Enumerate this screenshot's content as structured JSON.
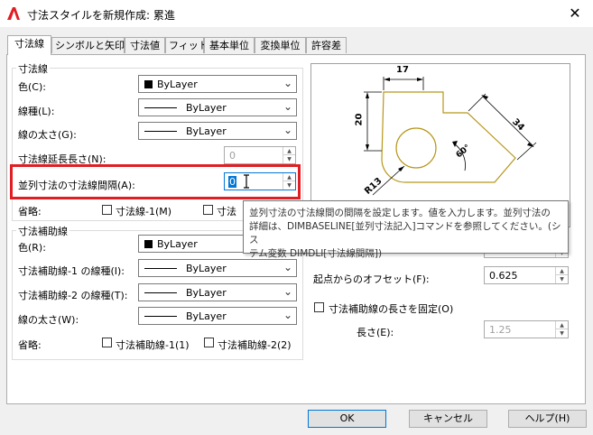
{
  "window": {
    "title": "寸法スタイルを新規作成: 累進",
    "close_glyph": "✕"
  },
  "tabs": [
    {
      "label": "寸法線"
    },
    {
      "label": "シンボルと矢印"
    },
    {
      "label": "寸法値"
    },
    {
      "label": "フィット"
    },
    {
      "label": "基本単位"
    },
    {
      "label": "変換単位"
    },
    {
      "label": "許容差"
    }
  ],
  "dim_lines": {
    "group_title": "寸法線",
    "color_label": "色(C):",
    "color_value": "ByLayer",
    "linetype_label": "線種(L):",
    "linetype_value": "ByLayer",
    "lineweight_label": "線の太さ(G):",
    "lineweight_value": "ByLayer",
    "extend_label": "寸法線延長長さ(N):",
    "extend_value": "0",
    "baseline_label": "並列寸法の寸法線間隔(A):",
    "baseline_value": "0",
    "suppress_label": "省略:",
    "suppress1_label": "寸法線-1(M)",
    "suppress2_label": "寸法"
  },
  "ext_lines": {
    "group_title": "寸法補助線",
    "color_label": "色(R):",
    "color_value": "ByLayer",
    "linetype1_label": "寸法補助線-1 の線種(I):",
    "linetype1_value": "ByLayer",
    "linetype2_label": "寸法補助線-2 の線種(T):",
    "linetype2_value": "ByLayer",
    "lineweight_label": "線の太さ(W):",
    "lineweight_value": "ByLayer",
    "suppress_label": "省略:",
    "suppress1_label": "寸法補助線-1(1)",
    "suppress2_label": "寸法補助線-2(2)",
    "offset_label": "起点からのオフセット(F):",
    "offset_value": "0.625",
    "fixed_label": "寸法補助線の長さを固定(O)",
    "length_label": "長さ(E):",
    "length_value": "1.25"
  },
  "tooltip": {
    "line1": "並列寸法の寸法線間の間隔を設定します。値を入力します。並列寸法の",
    "line2": "詳細は、DIMBASELINE[並列寸法記入]コマンドを参照してください。(シス",
    "line3": "テム変数 DIMDLI[寸法線間隔])"
  },
  "preview": {
    "dim_17": "17",
    "dim_20": "20",
    "dim_34": "34",
    "dim_60": "60°",
    "dim_r13": "R13"
  },
  "buttons": {
    "ok": "OK",
    "cancel": "キャンセル",
    "help": "ヘルプ(H)"
  },
  "colors": {
    "highlight": "#e01e24",
    "preview_shape": "#b8961a"
  }
}
